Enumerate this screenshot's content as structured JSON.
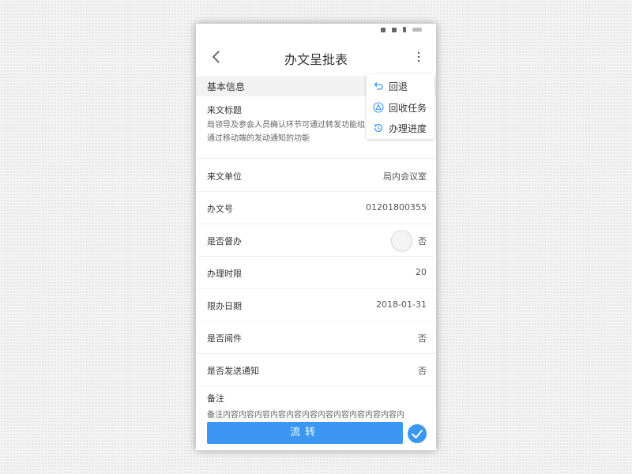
{
  "navbar": {
    "title": "办文呈批表"
  },
  "section": {
    "label": "基本信息"
  },
  "doc_title": {
    "label": "来文标题",
    "text_line1": "局领导及参会人员确认环节可通过转发功能组",
    "text_line2": "通过移动端的发动通知的功能"
  },
  "rows": [
    {
      "label": "来文单位",
      "value": "局内会议室"
    },
    {
      "label": "办文号",
      "value": "01201800355"
    },
    {
      "label": "是否督办",
      "value": "否"
    },
    {
      "label": "办理时限",
      "value": "20"
    },
    {
      "label": "限办日期",
      "value": "2018-01-31"
    },
    {
      "label": "是否阅件",
      "value": "否"
    },
    {
      "label": "是否发送通知",
      "value": "否"
    }
  ],
  "remark": {
    "label": "备注",
    "text": "备注内容内容内容内容内容内容内容内容内容内容内容内"
  },
  "footer": {
    "submit_label": "流转"
  },
  "menu": {
    "items": [
      {
        "label": "回退"
      },
      {
        "label": "回收任务"
      },
      {
        "label": "办理进度"
      }
    ]
  },
  "colors": {
    "accent": "#3b97f1"
  }
}
